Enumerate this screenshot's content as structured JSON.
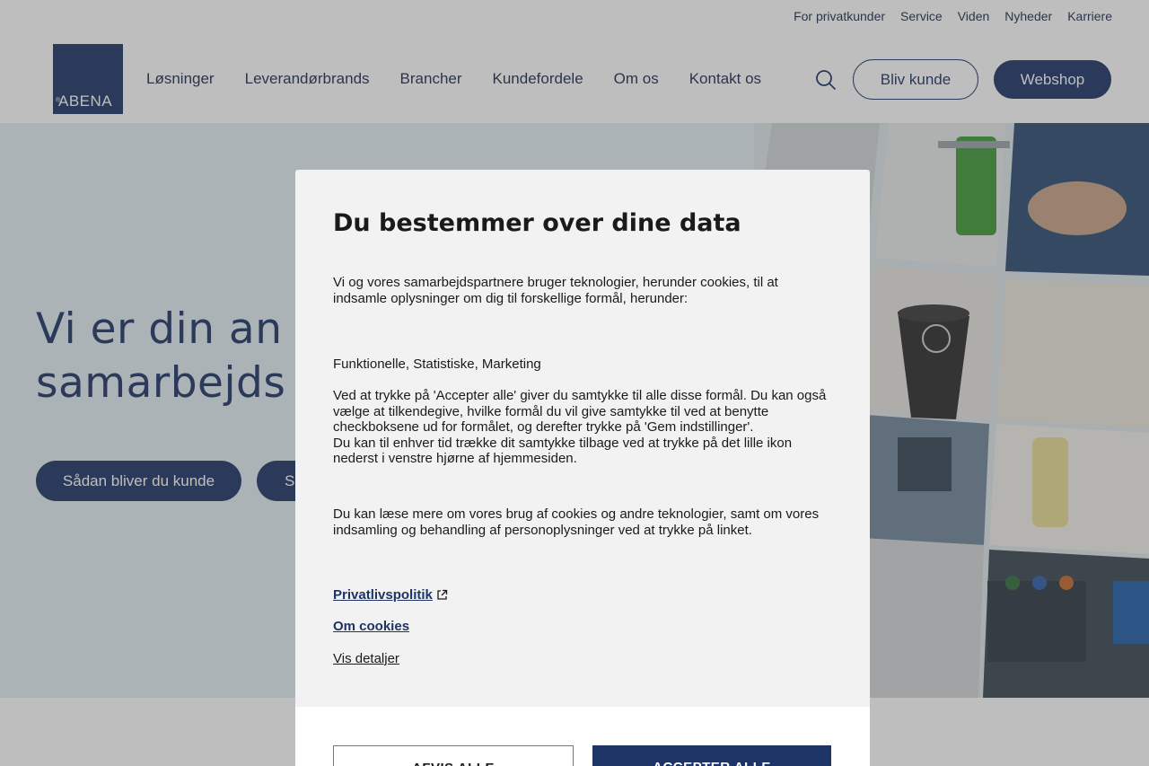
{
  "colors": {
    "brand": "#1e3466",
    "hero_bg": "#e3eef3",
    "modal_bg": "#f2f2f2"
  },
  "topnav": [
    "For privatkunder",
    "Service",
    "Viden",
    "Nyheder",
    "Karriere"
  ],
  "logo": {
    "text": "ABENA"
  },
  "mainnav": [
    "Løsninger",
    "Leverandørbrands",
    "Brancher",
    "Kundefordele",
    "Om os",
    "Kontakt os"
  ],
  "header": {
    "become_customer": "Bliv kunde",
    "webshop": "Webshop",
    "search_icon": "search-icon"
  },
  "hero": {
    "title_line1": "Vi er din an",
    "title_line2": "samarbejds",
    "button_primary": "Sådan bliver du kunde",
    "button_secondary": "S"
  },
  "modal": {
    "title": "Du bestemmer over dine data",
    "intro": "Vi og vores samarbejdspartnere bruger teknologier, herunder cookies, til at indsamle oplysninger om dig til forskellige formål, herunder:",
    "purposes": "Funktionelle, Statistiske, Marketing",
    "consent_line1": "Ved at trykke på 'Accepter alle' giver du samtykke til alle disse formål. Du kan også vælge at tilkendegive, hvilke formål du vil give samtykke til ved at benytte checkboksene ud for formålet, og derefter trykke på 'Gem indstillinger'.",
    "consent_line2": "Du kan til enhver tid trække dit samtykke tilbage ved at trykke på det lille ikon nederst i venstre hjørne af hjemmesiden.",
    "read_more": "Du kan læse mere om vores brug af cookies og andre teknologier, samt om vores indsamling og behandling af personoplysninger ved at trykke på linket.",
    "privacy_link": "Privatlivspolitik",
    "cookies_link": "Om cookies",
    "details_link": "Vis detaljer",
    "reject_button": "AFVIS ALLE",
    "accept_button": "ACCEPTER ALLE"
  }
}
